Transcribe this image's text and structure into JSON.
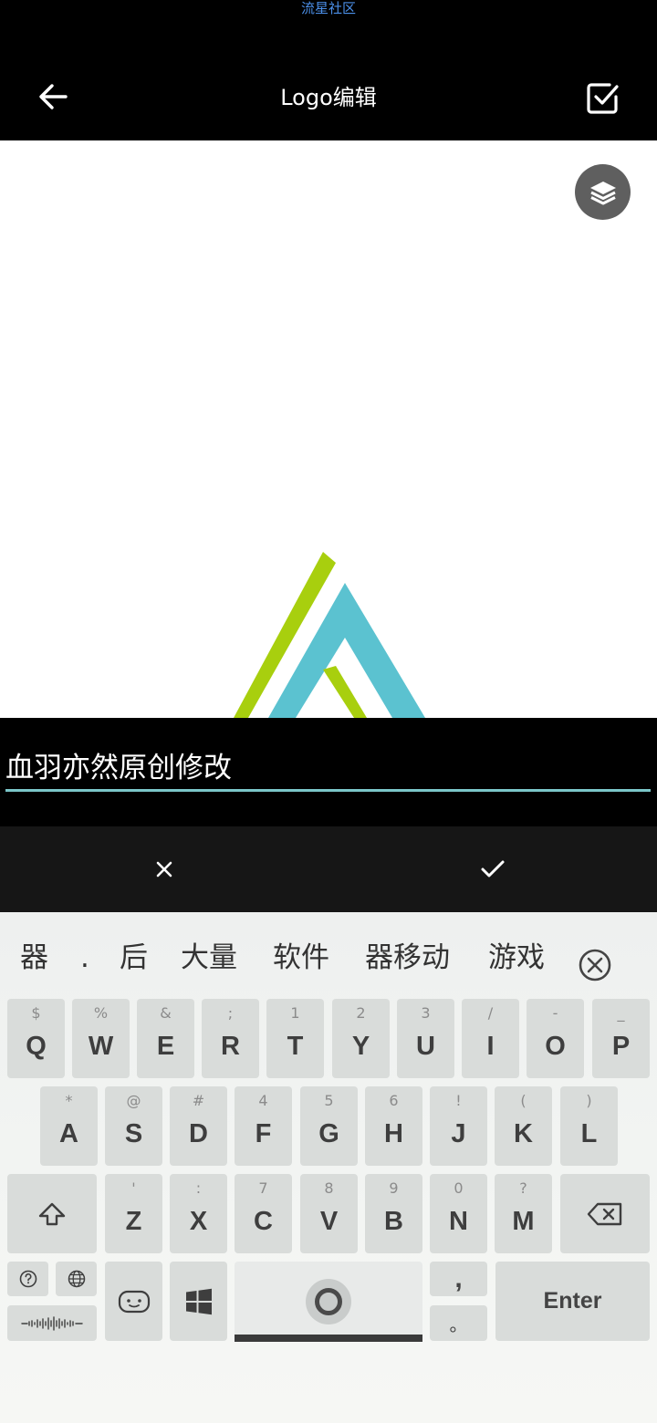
{
  "status_bar": {
    "label": "流星社区"
  },
  "appbar": {
    "title": "Logo编辑"
  },
  "editor": {
    "text_value": "血羽亦然原创修改"
  },
  "suggestions": [
    "器",
    ".",
    "后",
    "大量",
    "软件",
    "器移动",
    "游戏"
  ],
  "keyboard": {
    "row1": [
      {
        "sub": "$",
        "key": "Q"
      },
      {
        "sub": "%",
        "key": "W"
      },
      {
        "sub": "&",
        "key": "E"
      },
      {
        "sub": ";",
        "key": "R"
      },
      {
        "sub": "1",
        "key": "T"
      },
      {
        "sub": "2",
        "key": "Y"
      },
      {
        "sub": "3",
        "key": "U"
      },
      {
        "sub": "/",
        "key": "I"
      },
      {
        "sub": "-",
        "key": "O"
      },
      {
        "sub": "_",
        "key": "P"
      }
    ],
    "row2": [
      {
        "sub": "*",
        "key": "A"
      },
      {
        "sub": "@",
        "key": "S"
      },
      {
        "sub": "#",
        "key": "D"
      },
      {
        "sub": "4",
        "key": "F"
      },
      {
        "sub": "5",
        "key": "G"
      },
      {
        "sub": "6",
        "key": "H"
      },
      {
        "sub": "!",
        "key": "J"
      },
      {
        "sub": "(",
        "key": "K"
      },
      {
        "sub": ")",
        "key": "L"
      }
    ],
    "row3": [
      {
        "sub": "'",
        "key": "Z"
      },
      {
        "sub": ":",
        "key": "X"
      },
      {
        "sub": "7",
        "key": "C"
      },
      {
        "sub": "8",
        "key": "V"
      },
      {
        "sub": "9",
        "key": "B"
      },
      {
        "sub": "0",
        "key": "N"
      },
      {
        "sub": "?",
        "key": "M"
      }
    ],
    "comma": ",",
    "period": "。",
    "enter": "Enter"
  },
  "colors": {
    "accent": "#7bc6c9",
    "logo_green": "#a8cf0e",
    "logo_blue": "#5bc2d0",
    "status_label": "#4b8fe8"
  }
}
